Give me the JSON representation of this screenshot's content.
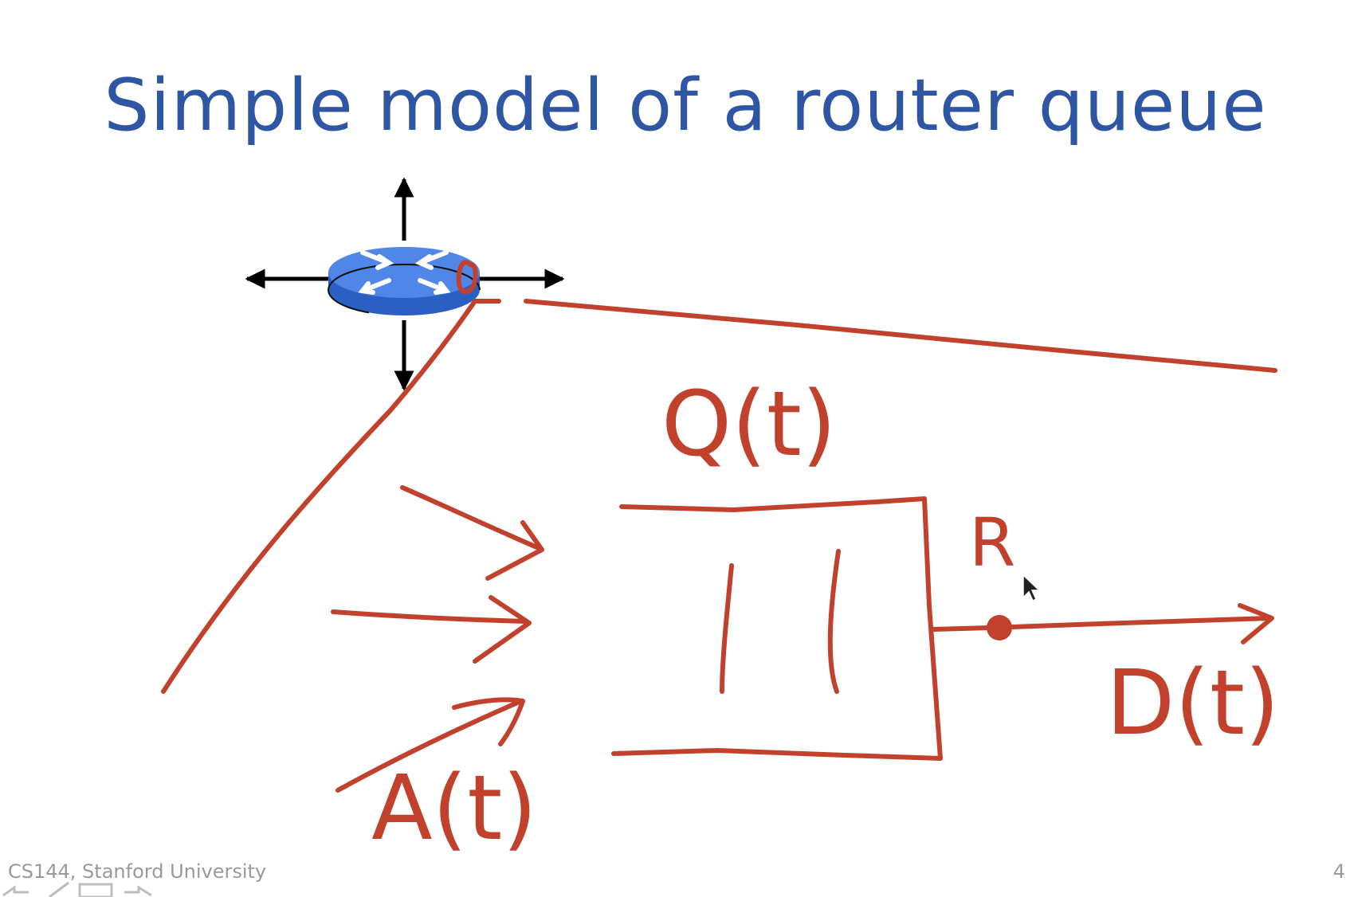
{
  "slide": {
    "title": "Simple model of a router queue",
    "footer": "CS144, Stanford University",
    "page_number": "4"
  },
  "diagram": {
    "labels": {
      "queue_occupancy": "Q(t)",
      "arrivals": "A(t)",
      "departures": "D(t)",
      "rate": "R"
    },
    "colors": {
      "title": "#2f56a4",
      "ink": "#c2412c",
      "router_top": "#4f86e8",
      "router_side": "#2c5fc4",
      "arrow": "#000000"
    },
    "icons": [
      "router-icon",
      "arrow-icon",
      "mouse-pointer-icon"
    ]
  }
}
